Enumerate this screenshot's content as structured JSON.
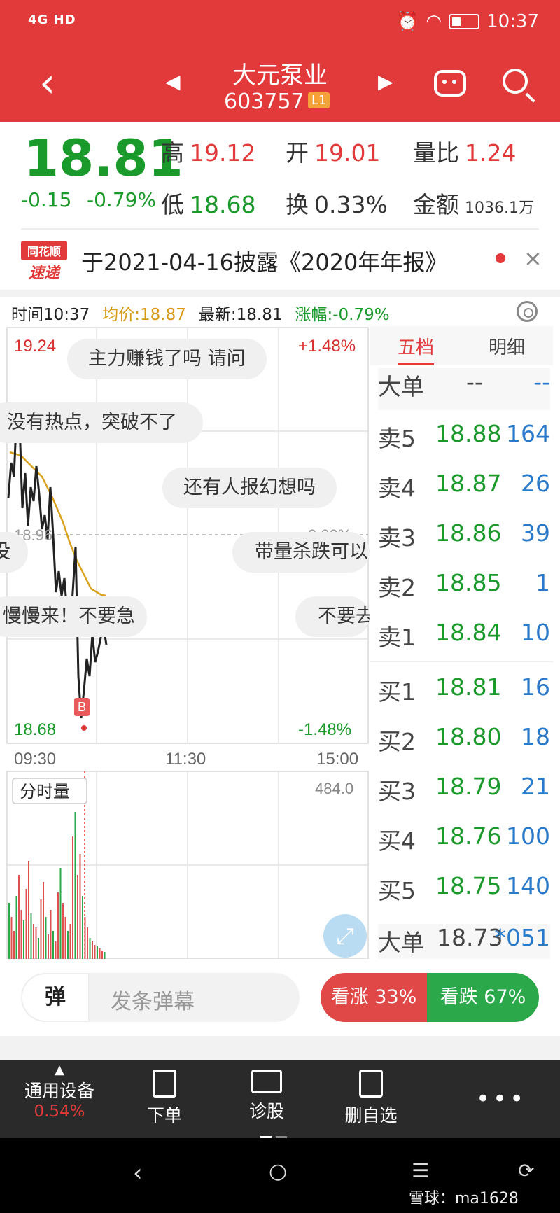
{
  "status": {
    "left": "4G HD",
    "time": "10:37"
  },
  "header": {
    "name": "大元泵业",
    "code": "603757",
    "badge": "L1"
  },
  "quote": {
    "price": "18.81",
    "change": "-0.15",
    "change_pct": "-0.79%",
    "high_label": "高",
    "high": "19.12",
    "open_label": "开",
    "open": "19.01",
    "vol_ratio_label": "量比",
    "vol_ratio": "1.24",
    "low_label": "低",
    "low": "18.68",
    "turnover_label": "换",
    "turnover": "0.33%",
    "amount_label": "金额",
    "amount": "1036.1万"
  },
  "notice": {
    "logo_top": "同花顺",
    "logo_bottom": "速递",
    "text": "于2021-04-16披露《2020年年报》"
  },
  "info": {
    "time": "时间10:37",
    "avg": "均价:18.87",
    "last": "最新:18.81",
    "pct": "涨幅:-0.79%"
  },
  "chart": {
    "y_high": "19.24",
    "y_low": "18.68",
    "y_mid": "18.96",
    "pct_high": "+1.48%",
    "pct_low": "-1.48%",
    "pct_mid": "0.00%",
    "x_labels": [
      "09:30",
      "11:30",
      "15:00"
    ],
    "marker": "B",
    "volume_label": "分时量",
    "volume_max": "484.0"
  },
  "barrage": [
    "主力赚钱了吗 请问",
    "没有热点，突破不了",
    "还有人报幻想吗",
    "带量杀跌可以",
    "慢慢来！不要急",
    "不要去",
    "没"
  ],
  "book": {
    "tab_active": "五档",
    "tab_other": "明细",
    "big_label": "大单",
    "big_a": "--",
    "big_b": "--",
    "asks": [
      {
        "label": "卖5",
        "price": "18.88",
        "qty": "164"
      },
      {
        "label": "卖4",
        "price": "18.87",
        "qty": "26"
      },
      {
        "label": "卖3",
        "price": "18.86",
        "qty": "39"
      },
      {
        "label": "卖2",
        "price": "18.85",
        "qty": "1"
      },
      {
        "label": "卖1",
        "price": "18.84",
        "qty": "10"
      }
    ],
    "bids": [
      {
        "label": "买1",
        "price": "18.81",
        "qty": "16"
      },
      {
        "label": "买2",
        "price": "18.80",
        "qty": "18"
      },
      {
        "label": "买3",
        "price": "18.79",
        "qty": "21"
      },
      {
        "label": "买4",
        "price": "18.76",
        "qty": "100"
      },
      {
        "label": "买5",
        "price": "18.75",
        "qty": "140"
      }
    ],
    "footer_label": "大单",
    "footer_price": "18.73",
    "footer_qty": "*051"
  },
  "bar": {
    "dan": "弹",
    "placeholder": "发条弹幕",
    "up": "看涨 33%",
    "down": "看跌 67%"
  },
  "nav": {
    "items": [
      {
        "label": "通用设备",
        "sub": "0.54%"
      },
      {
        "label": "下单"
      },
      {
        "label": "诊股"
      },
      {
        "label": "删自选"
      }
    ],
    "more": "•••"
  },
  "watermark": "雪球：ma1628"
}
